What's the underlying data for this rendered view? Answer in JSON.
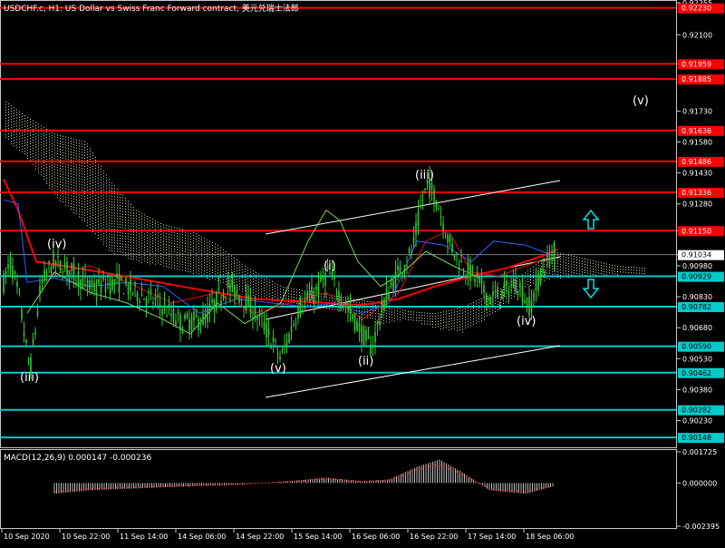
{
  "window": {
    "title": "USDCHF.c, H1:  US Dollar vs Swiss Franc Forward contract, 美元兑瑞士法郎",
    "indicator_label": "MACD(12,26,9) 0.000147 -0.000236"
  },
  "colors": {
    "background": "#000000",
    "candle": "#33cc33",
    "red_line": "#ff0000",
    "cyan_line": "#00ffff",
    "blue_line": "#3060ff",
    "channel": "#ffffff",
    "price_box_red": "#ff0000",
    "price_box_cyan": "#00cccc"
  },
  "chart_data": {
    "type": "candlestick",
    "symbol": "USDCHF.c",
    "timeframe": "H1",
    "ylim": [
      0.90118,
      0.92255
    ],
    "y_ticks": [
      "0.92255",
      "0.92100",
      "0.91959",
      "0.91730",
      "0.91580",
      "0.91430",
      "0.91280",
      "0.91150",
      "0.91034",
      "0.90980",
      "0.90830",
      "0.90680",
      "0.90530",
      "0.90380",
      "0.90230"
    ],
    "x_ticks": [
      "10 Sep 2020",
      "10 Sep 22:00",
      "11 Sep 14:00",
      "14 Sep 06:00",
      "14 Sep 22:00",
      "15 Sep 14:00",
      "16 Sep 06:00",
      "16 Sep 22:00",
      "17 Sep 14:00",
      "18 Sep 06:00"
    ],
    "current_price": "0.91034",
    "resistance_levels": [
      "0.92230",
      "0.91959",
      "0.91885",
      "0.91636",
      "0.91486",
      "0.91336",
      "0.91150"
    ],
    "support_levels": [
      "0.90929",
      "0.90782",
      "0.90590",
      "0.90462",
      "0.90282",
      "0.90148"
    ],
    "wave_labels": [
      {
        "text": "(iv)"
      },
      {
        "text": "(iii)"
      },
      {
        "text": "(v)"
      },
      {
        "text": "(i)"
      },
      {
        "text": "(ii)"
      },
      {
        "text": "(iii)"
      },
      {
        "text": "(iv)"
      },
      {
        "text": "(v)"
      }
    ],
    "macd": {
      "label": "MACD(12,26,9) 0.000147 -0.000236",
      "y_ticks": [
        "0.001725",
        "0.000000",
        "-0.002395"
      ]
    }
  }
}
